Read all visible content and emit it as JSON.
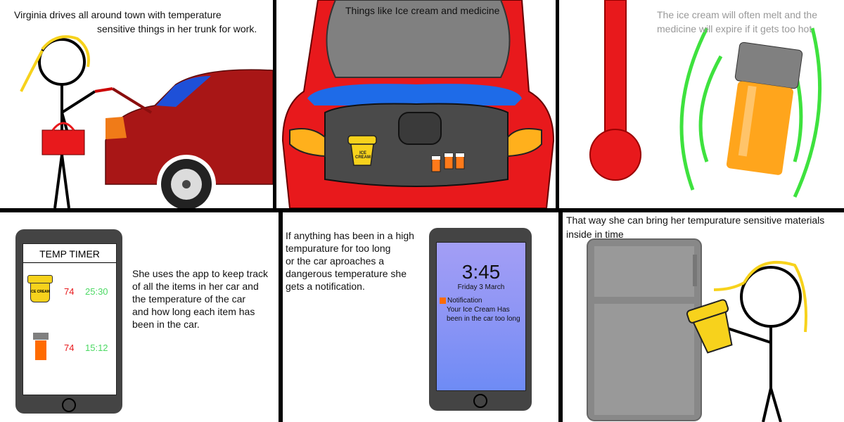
{
  "panels": {
    "p1": {
      "caption_line1": "Virginia drives all around town with temperature",
      "caption_line2": "sensitive things in her trunk for work."
    },
    "p2": {
      "caption": "Things like Ice cream and medicine",
      "ice_label": "ICE CREAM"
    },
    "p3": {
      "caption_line1": "The ice cream will often melt and the",
      "caption_line2": "medicine will expire if it gets too hot"
    },
    "p4": {
      "app_title": "TEMP TIMER",
      "items": [
        {
          "icon": "ice-cream-tub-icon",
          "label": "ICE CREAM",
          "temp": "74",
          "time": "25:30"
        },
        {
          "icon": "medicine-bottle-icon",
          "label": "",
          "temp": "74",
          "time": "15:12"
        }
      ],
      "caption_lines": [
        "She uses the app to keep track",
        "of all the items in her car and",
        "the temperature of the car",
        "and how long each item has",
        "been in the car."
      ]
    },
    "p5": {
      "caption_lines": [
        "If anything has been in a high",
        "tempurature for too long",
        "or the car aproaches a",
        "dangerous temperature she",
        "gets a notification."
      ],
      "lock_time": "3:45",
      "lock_date": "Friday 3 March",
      "notif_title": "Notification",
      "notif_line1": "Your Ice Cream Has",
      "notif_line2": "been in the car too long"
    },
    "p6": {
      "caption_line1": "That way she can bring her tempurature sensitive materials",
      "caption_line2": "inside in time"
    }
  },
  "colors": {
    "temp_red": "#e8191c",
    "timer_green": "#4cd964",
    "car_red": "#e01010",
    "car_dark_red": "#a01010",
    "hair_yellow": "#f7d21c",
    "green_wave": "#3ee23e",
    "pill_orange": "#ffa51c"
  }
}
